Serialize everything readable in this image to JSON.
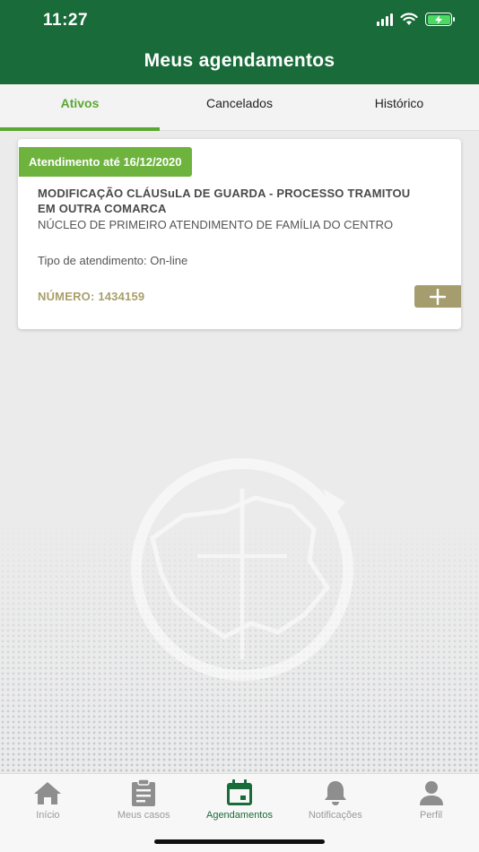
{
  "status_bar": {
    "time": "11:27"
  },
  "header": {
    "title": "Meus agendamentos"
  },
  "tabs": [
    {
      "label": "Ativos",
      "active": true
    },
    {
      "label": "Cancelados",
      "active": false
    },
    {
      "label": "Histórico",
      "active": false
    }
  ],
  "appointment": {
    "badge": "Atendimento até 16/12/2020",
    "title": "MODIFICAÇÃO CLÁUSuLA DE GUARDA - PROCESSO TRAMITOU EM OUTRA COMARCA",
    "office": "NÚCLEO DE PRIMEIRO ATENDIMENTO DE FAMÍLIA DO CENTRO",
    "type": "Tipo de atendimento: On-line",
    "number": "NÚMERO: 1434159",
    "add_icon": "plus-icon"
  },
  "bottom_nav": [
    {
      "label": "Início",
      "icon": "home-icon",
      "active": false
    },
    {
      "label": "Meus casos",
      "icon": "clipboard-icon",
      "active": false
    },
    {
      "label": "Agendamentos",
      "icon": "calendar-icon",
      "active": true
    },
    {
      "label": "Notificações",
      "icon": "bell-icon",
      "active": false
    },
    {
      "label": "Perfil",
      "icon": "person-icon",
      "active": false
    }
  ],
  "colors": {
    "primary": "#1a6b3a",
    "accent_green": "#6fb33f",
    "tab_active": "#5aa832",
    "gold": "#a69d6e"
  }
}
